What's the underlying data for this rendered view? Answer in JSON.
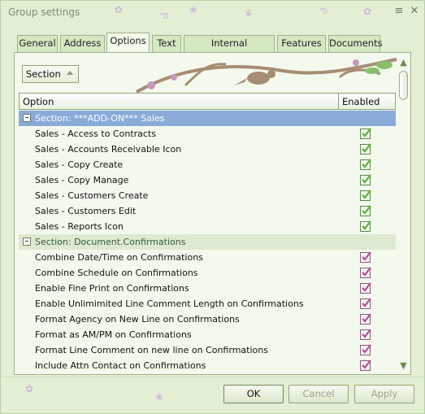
{
  "window": {
    "title": "Group settings"
  },
  "titlebar_buttons": {
    "minimize_icon": "minimize-icon",
    "close_icon": "close-icon"
  },
  "tabs": [
    {
      "label": "General",
      "active": false
    },
    {
      "label": "Address",
      "active": false
    },
    {
      "label": "Options",
      "active": true
    },
    {
      "label": "Text",
      "active": false
    },
    {
      "label": "Internal Information",
      "active": false
    },
    {
      "label": "Features",
      "active": false
    },
    {
      "label": "Documents",
      "active": false
    }
  ],
  "filter": {
    "value": "Section"
  },
  "grid": {
    "columns": [
      "Option",
      "Enabled"
    ],
    "sections": [
      {
        "label": "Section: ***ADD-ON*** Sales",
        "selected": true,
        "checkbox_color": "#5fae3a",
        "items": [
          {
            "label": "Sales - Access to Contracts",
            "enabled": true
          },
          {
            "label": "Sales - Accounts Receivable Icon",
            "enabled": true
          },
          {
            "label": "Sales - Copy Create",
            "enabled": true
          },
          {
            "label": "Sales - Copy Manage",
            "enabled": true
          },
          {
            "label": "Sales - Customers Create",
            "enabled": true
          },
          {
            "label": "Sales - Customers Edit",
            "enabled": true
          },
          {
            "label": "Sales - Reports Icon",
            "enabled": true
          }
        ]
      },
      {
        "label": "Section: Document.Confirmations",
        "selected": false,
        "checkbox_color": "#b0508e",
        "items": [
          {
            "label": "Combine Date/Time on Confirmations",
            "enabled": true
          },
          {
            "label": "Combine Schedule on Confirmations",
            "enabled": true
          },
          {
            "label": "Enable Fine Print on Confirmations",
            "enabled": true
          },
          {
            "label": "Enable Unlimimited Line Comment Length on Confirmations",
            "enabled": true
          },
          {
            "label": "Format Agency on New Line on Confirmations",
            "enabled": true
          },
          {
            "label": "Format as AM/PM on Confirmations",
            "enabled": true
          },
          {
            "label": "Format Line Comment on new line on Confirmations",
            "enabled": true
          },
          {
            "label": "Include Attn Contact on Confirmations",
            "enabled": true
          }
        ]
      }
    ]
  },
  "buttons": {
    "ok": "OK",
    "cancel": "Cancel",
    "apply": "Apply"
  }
}
